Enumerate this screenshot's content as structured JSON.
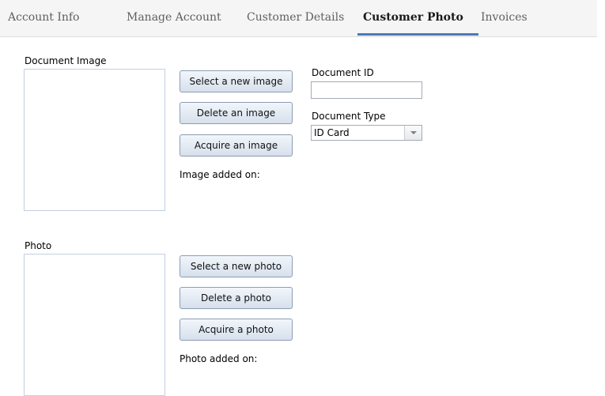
{
  "tabs": [
    {
      "label": "Account Info",
      "active": false
    },
    {
      "label": "Manage Account",
      "active": false
    },
    {
      "label": "Customer Details",
      "active": false
    },
    {
      "label": "Customer Photo",
      "active": true
    },
    {
      "label": "Invoices",
      "active": false
    }
  ],
  "colors": {
    "accent": "#4a7ab5",
    "frame_border": "#c3cfe0",
    "tabbar_bg": "#f5f5f5"
  },
  "document": {
    "section_label": "Document Image",
    "buttons": {
      "select": "Select a new image",
      "delete": "Delete an image",
      "acquire": "Acquire an image"
    },
    "added_on_label": "Image added on:",
    "id_label": "Document ID",
    "id_value": "",
    "type_label": "Document Type",
    "type_value": "ID Card"
  },
  "photo": {
    "section_label": "Photo",
    "buttons": {
      "select": "Select a new photo",
      "delete": "Delete a photo",
      "acquire": "Acquire a photo"
    },
    "added_on_label": "Photo added on:"
  }
}
